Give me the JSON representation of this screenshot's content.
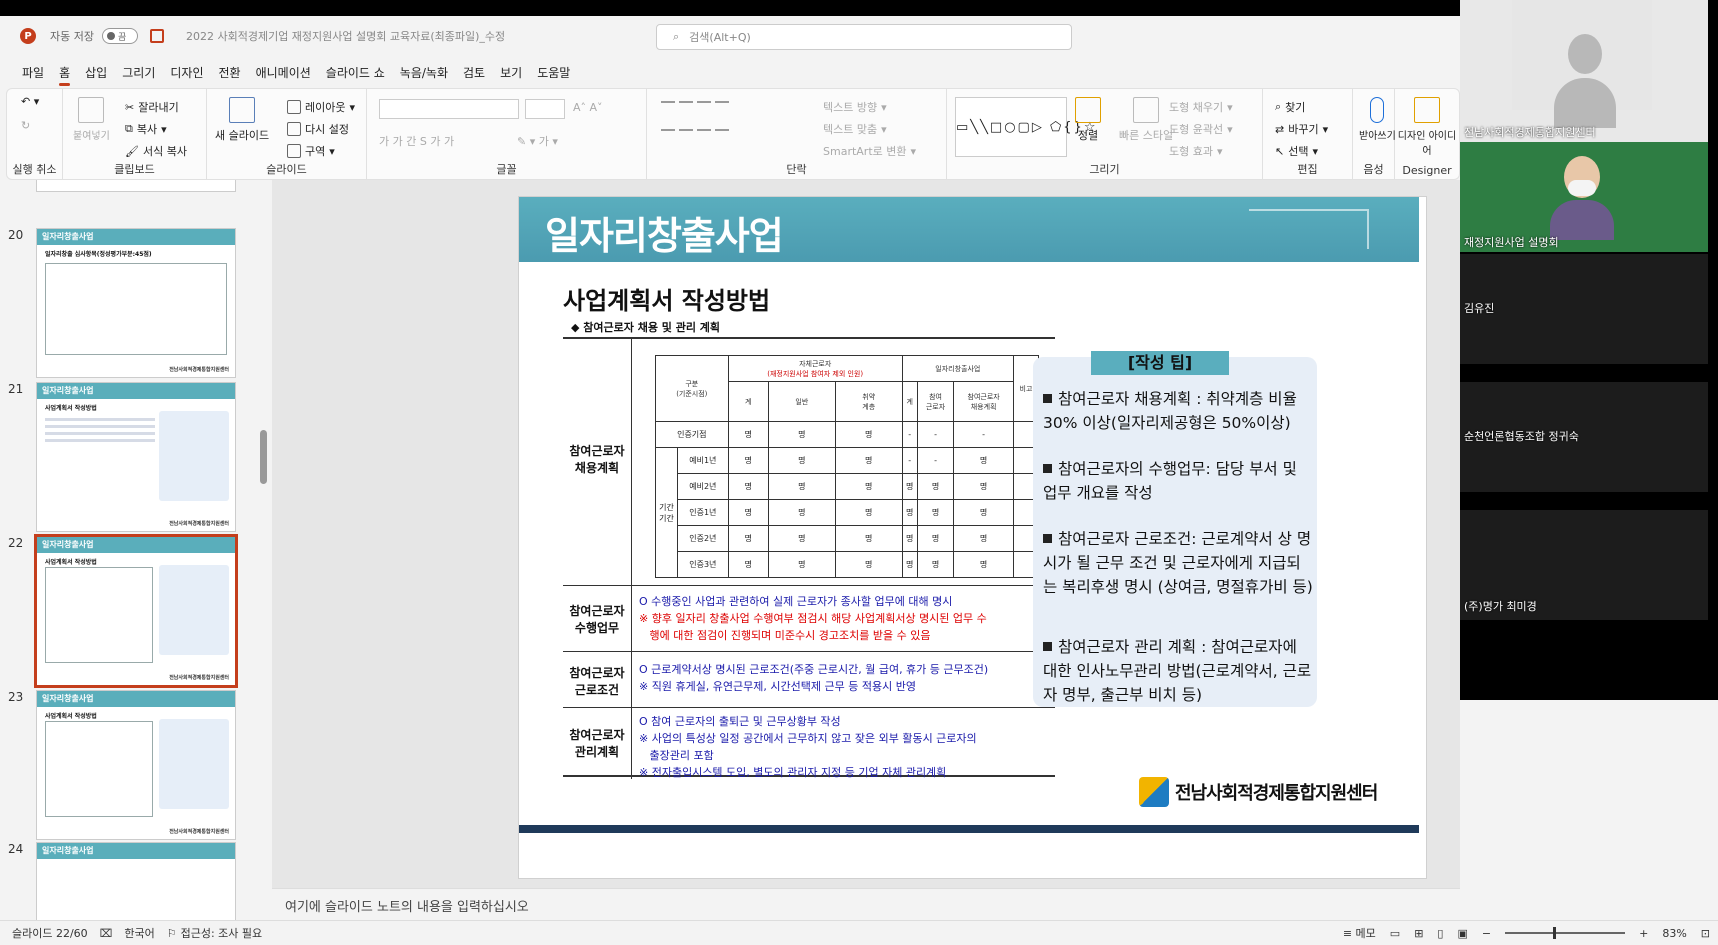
{
  "titlebar": {
    "logo_letter": "P",
    "autosave_label": "자동 저장",
    "autosave_state": "끔",
    "doc_title": "2022 사회적경제기업 재정지원사업 설명회 교육자료(최종파일)_수정",
    "search_placeholder": "검색(Alt+Q)"
  },
  "menu": {
    "tabs": [
      "파일",
      "홈",
      "삽입",
      "그리기",
      "디자인",
      "전환",
      "애니메이션",
      "슬라이드 쇼",
      "녹음/녹화",
      "검토",
      "보기",
      "도움말"
    ],
    "active": "홈"
  },
  "ribbon": {
    "undo_group": "실행 취소",
    "clipboard": {
      "label": "클립보드",
      "paste": "붙여넣기",
      "cut": "잘라내기",
      "copy": "복사",
      "format_copy": "서식 복사"
    },
    "slides": {
      "label": "슬라이드",
      "new_slide": "새 슬라이드",
      "layout": "레이아웃",
      "reset": "다시 설정",
      "section": "구역"
    },
    "font": {
      "label": "글꼴"
    },
    "paragraph": {
      "label": "단락",
      "text_direction": "텍스트 방향",
      "align_text": "텍스트 맞춤",
      "smartart": "SmartArt로 변환"
    },
    "drawing": {
      "label": "그리기",
      "arrange": "정렬",
      "quick_styles": "빠른 스타일",
      "fill": "도형 채우기",
      "outline": "도형 윤곽선",
      "effects": "도형 효과"
    },
    "editing": {
      "label": "편집",
      "find": "찾기",
      "replace": "바꾸기",
      "select": "선택"
    },
    "voice": {
      "label": "음성",
      "dictate": "받아쓰기"
    },
    "designer": {
      "label": "Designer",
      "ideas": "디자인 아이디어"
    }
  },
  "thumbnails": {
    "items": [
      {
        "num": "20",
        "title": "일자리창출사업",
        "sub": "일자리창출 심사항목(정성평가부분:45점)"
      },
      {
        "num": "21",
        "title": "일자리창출사업",
        "sub": "사업계획서 작성방법"
      },
      {
        "num": "22",
        "title": "일자리창출사업",
        "sub": "사업계획서 작성방법",
        "selected": true
      },
      {
        "num": "23",
        "title": "일자리창출사업",
        "sub": "사업계획서 작성방법"
      },
      {
        "num": "24",
        "title": "일자리창출사업",
        "sub": ""
      }
    ],
    "footer_org": "전남사회적경제통합지원센터"
  },
  "slide": {
    "header": "일자리창출사업",
    "subtitle": "사업계획서 작성방법",
    "section_bullet": "◆ 참여근로자 채용 및 관리 계획",
    "rows": {
      "hire_plan": "참여근로자\n채용계획",
      "duties": "참여근로자\n수행업무",
      "conditions": "참여근로자\n근로조건",
      "management": "참여근로자\n관리계획"
    },
    "table": {
      "h_category": "구분\n(기준시점)",
      "h_group1": "자체근로자",
      "h_group1_note": "(재정지원사업 참여자 제외 인원)",
      "h_group2": "일자리창출사업",
      "h_note": "비고",
      "h_total": "계",
      "h_general": "일반",
      "h_vulnerable": "취약\n계층",
      "h_total2": "계",
      "h_participant": "참여\n근로자",
      "h_plan": "참여근로자\n채용계획",
      "period_label": "기간\n기간",
      "unit": "명",
      "dash": "-",
      "rows": [
        "인증기점",
        "예비1년",
        "예비2년",
        "인증1년",
        "인증2년",
        "인증3년"
      ]
    },
    "duties_lines": [
      "O 수행중인 사업과 관련하여 실제 근로자가 종사할 업무에 대해 명시",
      "※ 향후 일자리 창출사업 수행여부 점검시 해당 사업계획서상 명시된 업무 수",
      "   행에 대한 점검이 진행되며 미준수시 경고조치를 받을 수 있음"
    ],
    "conditions_lines": [
      "O 근로계약서상 명시된 근로조건(주중 근로시간, 월 급여, 휴가 등 근무조건)",
      "※ 직원 휴게실, 유연근무제, 시간선택제 근무 등 적용시 반영"
    ],
    "management_lines": [
      "O 참여 근로자의 출퇴근 및 근무상황부 작성",
      "※ 사업의 특성상 일정 공간에서 근무하지 않고 잦은 외부 활동시 근로자의",
      "   출장관리 포함",
      "※ 전자출입시스템 도입, 별도의 관리자 지정 등 기업 자체 관리계획"
    ],
    "tip_title": "[작성 팁]",
    "tips": [
      "참여근로자 채용계획 : 취약계층 비율 30% 이상(일자리제공형은 50%이상)",
      "참여근로자의 수행업무: 담당 부서 및 업무 개요를 작성",
      "참여근로자 근로조건: 근로계약서 상 명시가 될 근무 조건 및 근로자에게 지급되는 복리후생 명시 (상여금, 명절휴가비 등)",
      "참여근로자 관리 계획 : 참여근로자에 대한 인사노무관리 방법(근로계약서, 근로자 명부, 출근부 비치 등)"
    ],
    "logo_text": "전남사회적경제통합지원센터"
  },
  "notes_placeholder": "여기에 슬라이드 노트의 내용을 입력하십시오",
  "status": {
    "slide_pos": "슬라이드 22/60",
    "language": "한국어",
    "accessibility": "접근성: 조사 필요",
    "memo": "메모",
    "zoom": "83%"
  },
  "participants": [
    {
      "name": "전남사회적경제통합지원센터",
      "kind": "photo"
    },
    {
      "name": "재정지원사업 설명회",
      "kind": "live"
    },
    {
      "name": "김유진",
      "kind": "dark"
    },
    {
      "name": "순천언론협동조합 정귀숙",
      "kind": "dark"
    },
    {
      "name": "(주)명가 최미경",
      "kind": "dark"
    }
  ],
  "colors": {
    "accent": "#c43e1c",
    "slide_header": "#5aaebe",
    "tip_bg": "#e7eef7",
    "link_blue": "#1a1aaa",
    "warn_red": "#d00000"
  }
}
